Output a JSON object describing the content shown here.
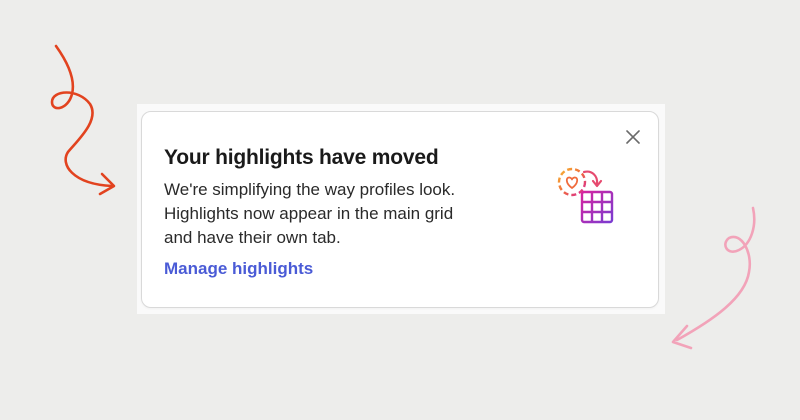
{
  "card": {
    "title": "Your highlights have moved",
    "description_lines": [
      "We're simplifying the way profiles look.",
      "Highlights now appear in the main grid",
      "and have their own tab."
    ],
    "link_label": "Manage highlights",
    "close_icon": "close-icon",
    "illustration_icon": "highlights-grid-icon"
  },
  "colors": {
    "background": "#ededeb",
    "card_bg": "#ffffff",
    "link": "#4a5bd6",
    "arrow_left": "#e2431f",
    "arrow_right": "#f2a3b9"
  }
}
